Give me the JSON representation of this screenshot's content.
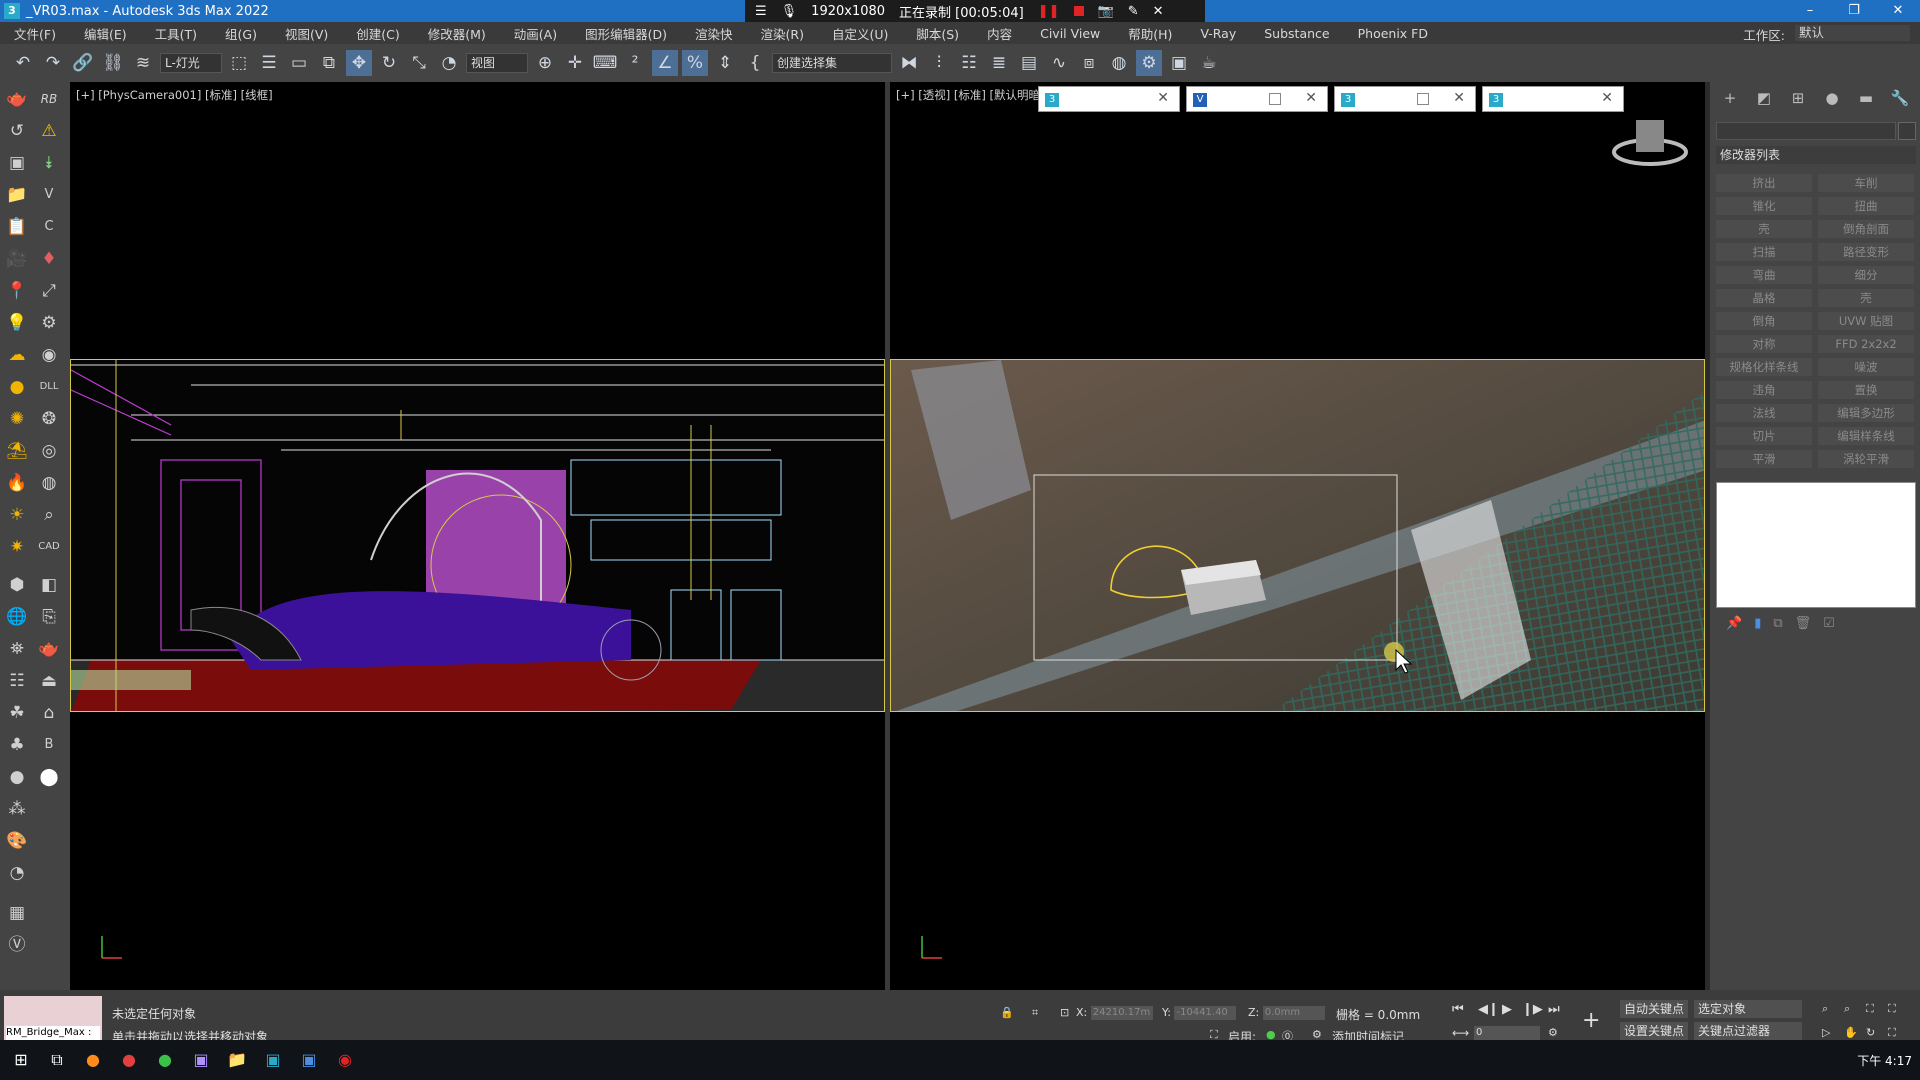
{
  "window": {
    "title": "_VR03.max - Autodesk 3ds Max 2022",
    "app_icon": "3"
  },
  "recording": {
    "resolution": "1920x1080",
    "status": "正在录制 [00:05:04]"
  },
  "menu": [
    "文件(F)",
    "编辑(E)",
    "工具(T)",
    "组(G)",
    "视图(V)",
    "创建(C)",
    "修改器(M)",
    "动画(A)",
    "图形编辑器(D)",
    "渲染快",
    "渲染(R)",
    "自定义(U)",
    "脚本(S)",
    "内容",
    "Civil View",
    "帮助(H)",
    "V-Ray",
    "Substance",
    "Phoenix FD"
  ],
  "workspace": {
    "label": "工作区:",
    "value": "默认"
  },
  "toolbar": {
    "filter_select": "L-灯光",
    "coord_select": "视图",
    "selection_set": "创建选择集"
  },
  "left_strip": {
    "labels": [
      "RB",
      "V",
      "C",
      "DLL",
      "CAD",
      "B"
    ]
  },
  "viewports": {
    "left_label": "[+] [PhysCamera001] [标准] [线框]",
    "right_label": "[+] [透视] [标准] [默认明暗"
  },
  "popup_tabs": [
    {
      "icon": "3"
    },
    {
      "icon": "V"
    },
    {
      "icon": "3"
    },
    {
      "icon": "3"
    }
  ],
  "command_panel": {
    "modifier_list": "修改器列表",
    "modifiers": [
      "挤出",
      "车削",
      "锥化",
      "扭曲",
      "壳",
      "倒角剖面",
      "扫描",
      "路径变形",
      "弯曲",
      "细分",
      "晶格",
      "壳",
      "倒角",
      "UVW 贴图",
      "对称",
      "FFD 2x2x2",
      "规格化样条线",
      "噪波",
      "违角",
      "置换",
      "法线",
      "编辑多边形",
      "切片",
      "编辑样条线",
      "平滑",
      "涡轮平滑"
    ]
  },
  "status": {
    "maxscript": "RM_Bridge_Max :",
    "line1": "未选定任何对象",
    "line2": "单击并拖动以选择并移动对象",
    "x_label": "X:",
    "x_value": "24210.17m",
    "y_label": "Y:",
    "y_value": "-10441.40",
    "z_label": "Z:",
    "z_value": "0.0mm",
    "grid": "栅格 = 0.0mm",
    "enable": "启用:",
    "add_time_tag": "添加时间标记",
    "auto_key": "自动关键点",
    "selected_obj": "选定对象",
    "set_key": "设置关键点",
    "key_filter": "关键点过滤器",
    "frame": "0"
  },
  "taskbar": {
    "clock": "下午 4:17"
  },
  "colors": {
    "titlebar": "#1f6fc2",
    "accent_yellow": "#d8c84a"
  }
}
